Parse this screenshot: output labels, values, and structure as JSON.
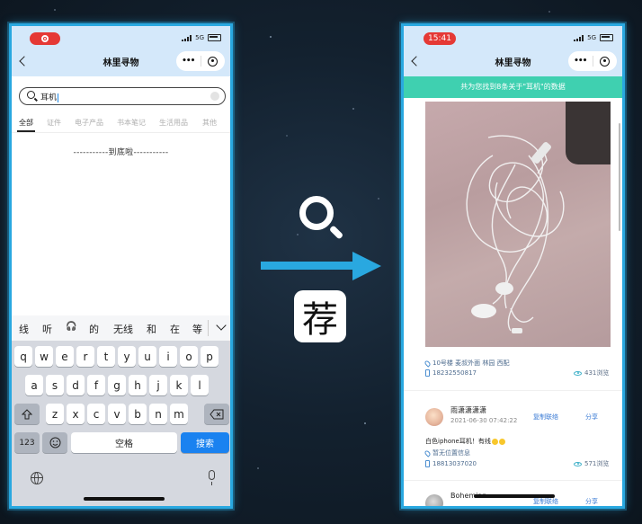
{
  "left_phone": {
    "nav_title": "林里寻物",
    "more_button": "•••",
    "status_network": "5G",
    "search": {
      "value": "耳机"
    },
    "categories": [
      "全部",
      "证件",
      "电子产品",
      "书本笔记",
      "生活用品",
      "其他"
    ],
    "end_text": "-----------到底啦-----------",
    "suggestions": [
      "线",
      "听",
      "的",
      "无线",
      "和",
      "在",
      "等"
    ],
    "keyboard": {
      "row1": [
        "q",
        "w",
        "e",
        "r",
        "t",
        "y",
        "u",
        "i",
        "o",
        "p"
      ],
      "row2": [
        "a",
        "s",
        "d",
        "f",
        "g",
        "h",
        "j",
        "k",
        "l"
      ],
      "row3": [
        "z",
        "x",
        "c",
        "v",
        "b",
        "n",
        "m"
      ],
      "num_key": "123",
      "space_key": "空格",
      "search_key": "搜索"
    }
  },
  "middle": {
    "recommend_char": "荐"
  },
  "right_phone": {
    "status_time": "15:41",
    "status_network": "5G",
    "nav_title": "林里寻物",
    "more_button": "•••",
    "banner": "共为您找到8条关于\"耳机\"的数据",
    "posts": [
      {
        "location": "10号楼 麦叔外面 林园 西配",
        "phone": "18232550817",
        "views": "431浏览"
      },
      {
        "username": "雨潇潇潇潇",
        "date": "2021-06-30 07:42:22",
        "copy_contact": "复制联络",
        "share": "分享",
        "description": "白色iphone耳机！有线",
        "location": "暂无位置信息",
        "phone": "18813037020",
        "views": "571浏览"
      },
      {
        "username": "Bohemian",
        "copy_contact": "复制联络",
        "share": "分享"
      }
    ]
  }
}
